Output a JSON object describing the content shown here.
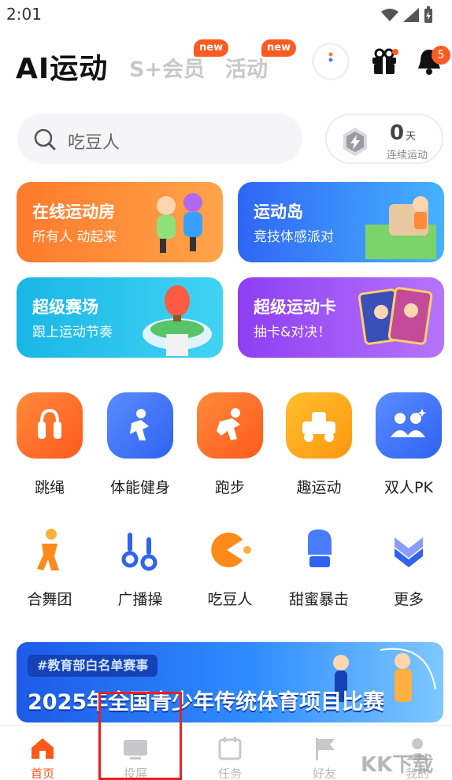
{
  "status": {
    "time": "2:01"
  },
  "header": {
    "title": "AI运动",
    "tabs": [
      {
        "label": "S+会员",
        "badge": "new"
      },
      {
        "label": "活动",
        "badge": "new"
      }
    ],
    "notification_count": "5"
  },
  "search": {
    "placeholder": "吃豆人"
  },
  "streak": {
    "value": "0",
    "unit": "天",
    "label": "连续运动"
  },
  "feature_cards": [
    {
      "title": "在线运动房",
      "subtitle": "所有人 动起来"
    },
    {
      "title": "运动岛",
      "subtitle": "竞技体感派对"
    },
    {
      "title": "超级赛场",
      "subtitle": "跟上运动节奏"
    },
    {
      "title": "超级运动卡",
      "subtitle": "抽卡&对决！"
    }
  ],
  "main_grid": [
    {
      "label": "跳绳",
      "icon": "jump-rope-icon"
    },
    {
      "label": "体能健身",
      "icon": "fitness-icon"
    },
    {
      "label": "跑步",
      "icon": "running-icon"
    },
    {
      "label": "趣运动",
      "icon": "fun-sport-icon"
    },
    {
      "label": "双人PK",
      "icon": "pk-icon"
    }
  ],
  "sub_grid": [
    {
      "label": "合舞团",
      "icon": "dance-icon"
    },
    {
      "label": "广播操",
      "icon": "exercise-icon"
    },
    {
      "label": "吃豆人",
      "icon": "pacman-icon"
    },
    {
      "label": "甜蜜暴击",
      "icon": "boxing-glove-icon"
    },
    {
      "label": "更多",
      "icon": "more-chevron-icon"
    }
  ],
  "banner": {
    "tag": "#教育部白名单赛事",
    "headline": "2025年全国青少年传统体育项目比赛"
  },
  "tabbar": [
    {
      "label": "首页",
      "active": true
    },
    {
      "label": "投屏",
      "active": false
    },
    {
      "label": "任务",
      "active": false
    },
    {
      "label": "好友",
      "active": false
    },
    {
      "label": "我的",
      "active": false
    }
  ],
  "watermark": "KK下载",
  "colors": {
    "accent": "#ff5a1c",
    "blue": "#2f63f0"
  }
}
